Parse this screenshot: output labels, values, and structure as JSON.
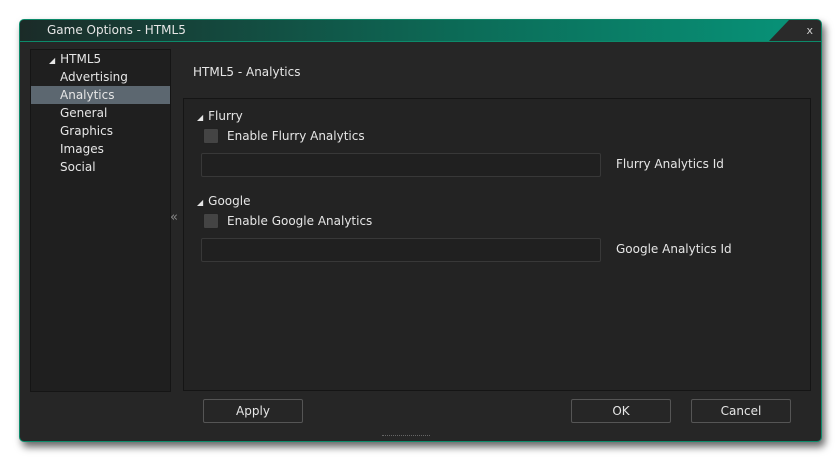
{
  "window": {
    "title": "Game Options - HTML5",
    "close": "x"
  },
  "tree": {
    "root": "HTML5",
    "items": [
      "Advertising",
      "Analytics",
      "General",
      "Graphics",
      "Images",
      "Social"
    ],
    "selected": "Analytics",
    "collapse": "«"
  },
  "main": {
    "heading": "HTML5 - Analytics",
    "sections": [
      {
        "name": "Flurry",
        "checkbox": "Enable Flurry Analytics",
        "checked": false,
        "field_label": "Flurry Analytics Id",
        "value": ""
      },
      {
        "name": "Google",
        "checkbox": "Enable Google Analytics",
        "checked": false,
        "field_label": "Google Analytics Id",
        "value": ""
      }
    ]
  },
  "buttons": {
    "apply": "Apply",
    "ok": "OK",
    "cancel": "Cancel"
  }
}
